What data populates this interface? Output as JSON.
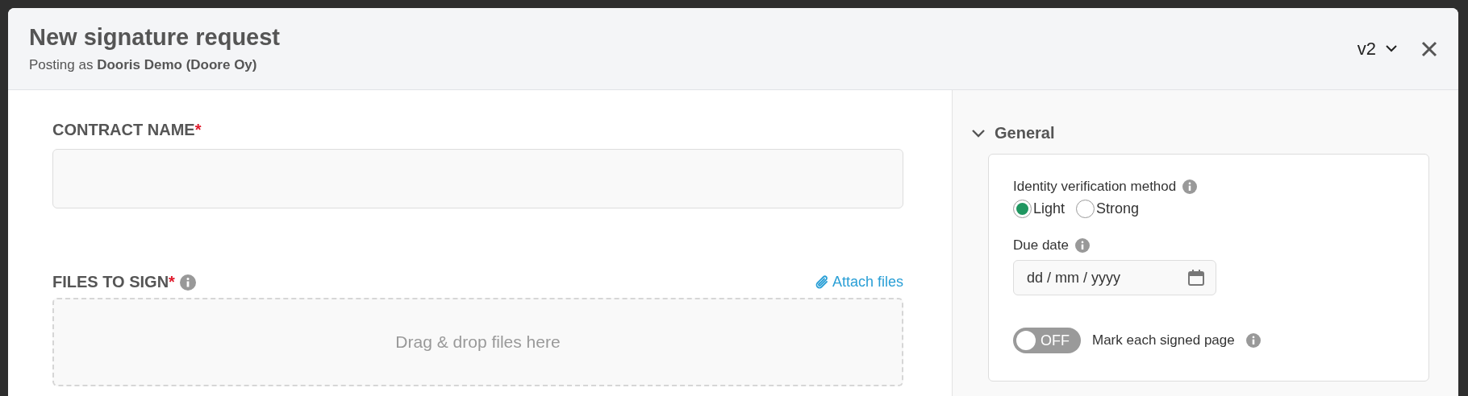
{
  "dialog": {
    "title": "New signature request",
    "posting_as_prefix": "Posting as",
    "posting_as_name": "Dooris Demo (Doore Oy)",
    "version": "v2"
  },
  "form": {
    "contract_name": {
      "label": "CONTRACT NAME",
      "required_mark": "*"
    },
    "files": {
      "label": "FILES TO SIGN",
      "required_mark": "*",
      "attach": "Attach files",
      "dropzone": "Drag & drop files here"
    }
  },
  "sidebar": {
    "section": {
      "title": "General",
      "expanded": true
    },
    "identity": {
      "label": "Identity verification method",
      "options": [
        {
          "label": "Light",
          "selected": true
        },
        {
          "label": "Strong",
          "selected": false
        }
      ]
    },
    "due_date": {
      "label": "Due date",
      "placeholder": "dd / mm / yyyy"
    },
    "mark_pages": {
      "label": "Mark each signed page",
      "on": false,
      "toggle_text": "OFF"
    }
  }
}
